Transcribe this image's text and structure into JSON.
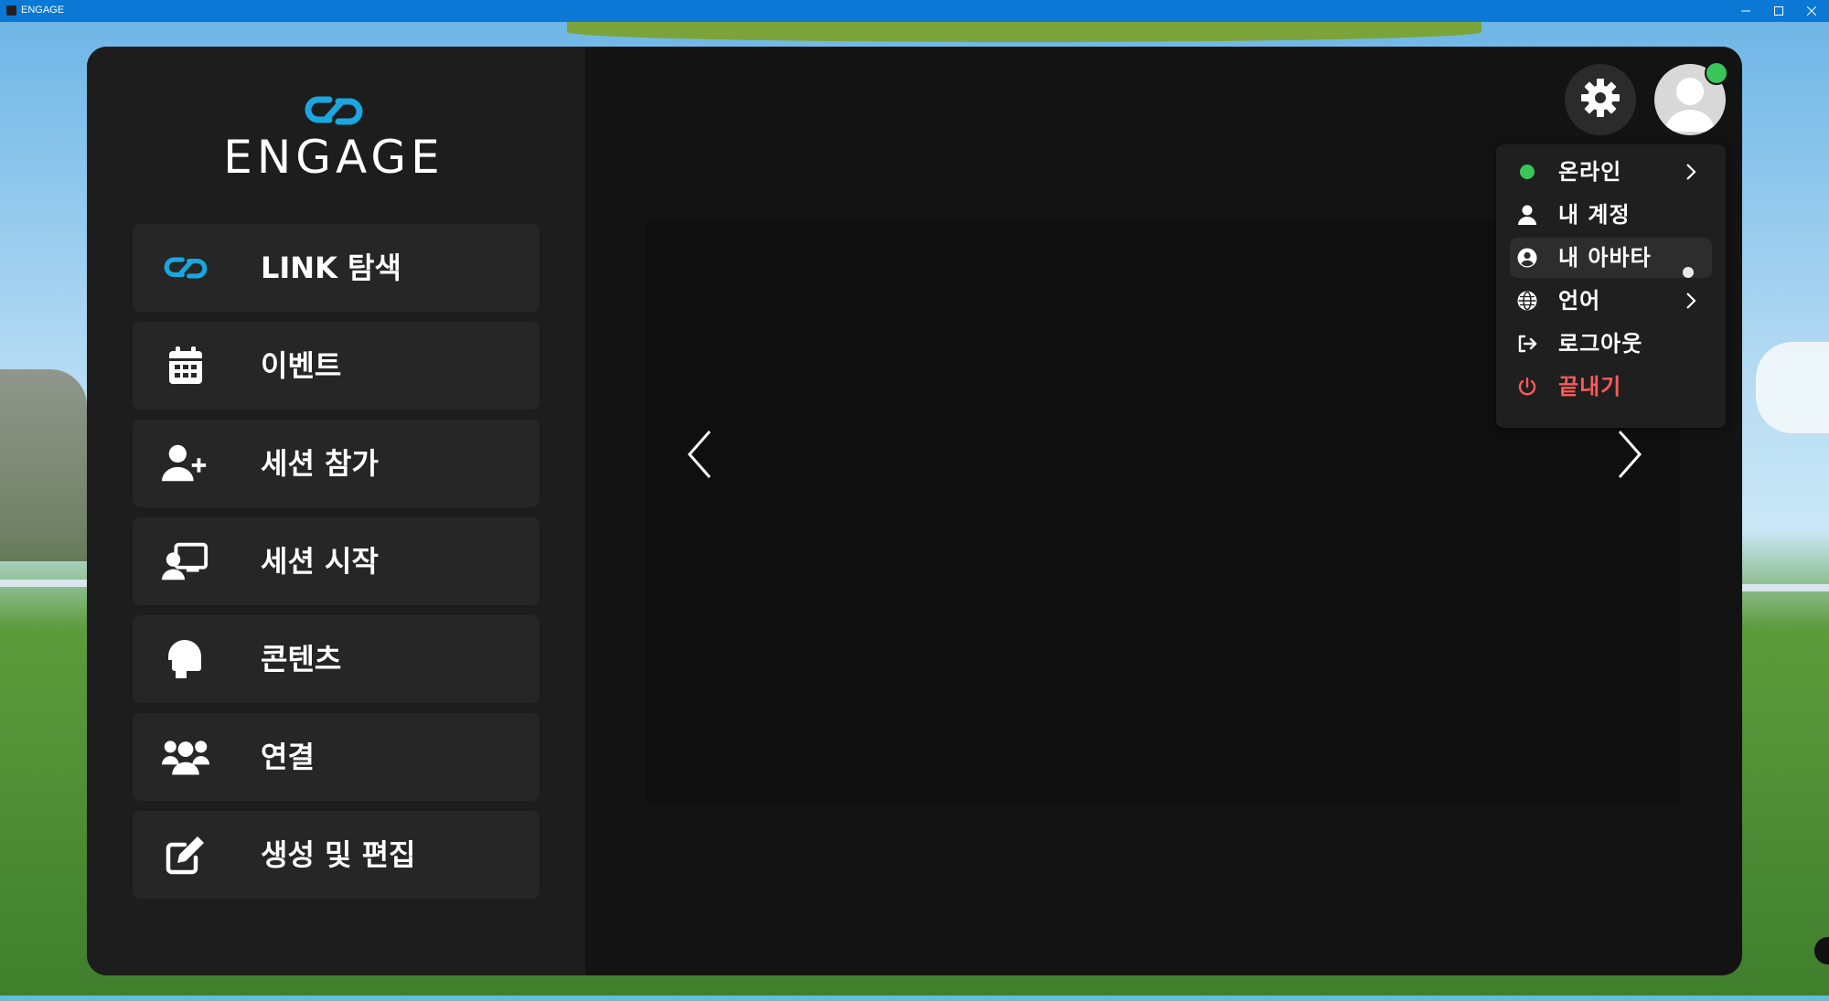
{
  "window": {
    "title": "ENGAGE"
  },
  "logo": {
    "text": "ENGAGE",
    "accent": "#1aa6de"
  },
  "sidebar": {
    "items": [
      {
        "label": "LINK 탐색",
        "icon": "link-icon"
      },
      {
        "label": "이벤트",
        "icon": "calendar-icon"
      },
      {
        "label": "세션 참가",
        "icon": "user-plus-icon"
      },
      {
        "label": "세션 시작",
        "icon": "presenter-icon"
      },
      {
        "label": "콘텐츠",
        "icon": "vr-headset-icon"
      },
      {
        "label": "연결",
        "icon": "users-icon"
      },
      {
        "label": "생성 및 편집",
        "icon": "edit-icon"
      }
    ]
  },
  "header": {
    "settings_icon": "gear-icon",
    "avatar_icon": "user-avatar-icon",
    "status_color": "#3ac55a"
  },
  "menu": {
    "items": [
      {
        "label": "온라인",
        "icon": "online-dot-icon",
        "has_submenu": true
      },
      {
        "label": "내 계정",
        "icon": "user-icon",
        "has_submenu": false
      },
      {
        "label": "내 아바타",
        "icon": "user-circle-icon",
        "has_submenu": false
      },
      {
        "label": "언어",
        "icon": "globe-icon",
        "has_submenu": true
      },
      {
        "label": "로그아웃",
        "icon": "logout-icon",
        "has_submenu": false
      },
      {
        "label": "끝내기",
        "icon": "power-icon",
        "has_submenu": false,
        "color": "#ff5a5a"
      }
    ]
  },
  "carousel": {
    "prev_icon": "chevron-left-icon",
    "next_icon": "chevron-right-icon"
  }
}
